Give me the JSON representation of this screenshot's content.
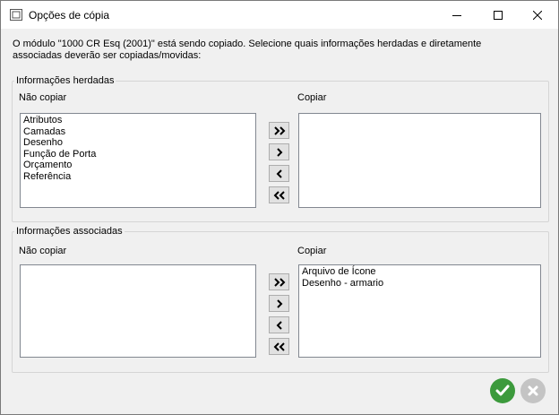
{
  "window": {
    "title": "Opções de cópia",
    "controls": {
      "minimize": "minimize-icon",
      "maximize": "maximize-icon",
      "close": "close-icon"
    }
  },
  "intro_text": "O módulo \"1000 CR Esq (2001)\" está sendo copiado. Selecione quais informações herdadas e diretamente associadas deverão ser copiadas/movidas:",
  "inherited": {
    "legend": "Informações herdadas",
    "left_label": "Não copiar",
    "right_label": "Copiar",
    "left_items": [
      "Atributos",
      "Camadas",
      "Desenho",
      "Função de Porta",
      "Orçamento",
      "Referência"
    ],
    "right_items": []
  },
  "associated": {
    "legend": "Informações associadas",
    "left_label": "Não copiar",
    "right_label": "Copiar",
    "left_items": [],
    "right_items": [
      "Arquivo de Ícone",
      "Desenho - armario"
    ]
  },
  "move_buttons": {
    "move_all_right": "»",
    "move_right": "›",
    "move_left": "‹",
    "move_all_left": "«"
  },
  "colors": {
    "ok_green": "#3c9a3c",
    "cancel_grey": "#c4c4c4"
  }
}
